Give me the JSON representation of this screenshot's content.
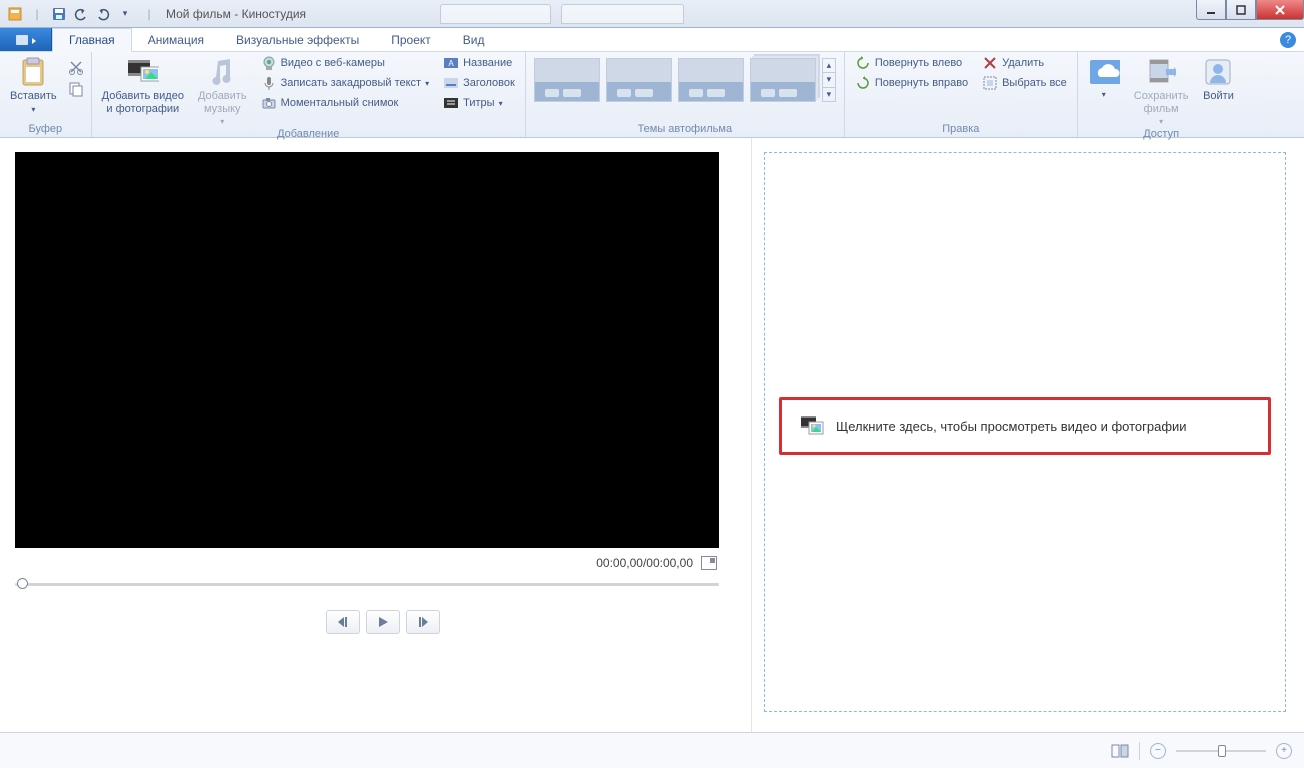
{
  "window": {
    "title": "Мой фильм - Киностудия"
  },
  "tabs": {
    "home": "Главная",
    "animation": "Анимация",
    "effects": "Визуальные эффекты",
    "project": "Проект",
    "view": "Вид"
  },
  "ribbon": {
    "clipboard": {
      "paste": "Вставить",
      "group": "Буфер"
    },
    "add": {
      "add_media": "Добавить видео\nи фотографии",
      "add_music": "Добавить\nмузыку",
      "webcam": "Видео с веб-камеры",
      "narration": "Записать закадровый текст",
      "snapshot": "Моментальный снимок",
      "title": "Название",
      "caption": "Заголовок",
      "credits": "Титры",
      "group": "Добавление"
    },
    "themes": {
      "group": "Темы автофильма"
    },
    "edit": {
      "rotate_left": "Повернуть влево",
      "rotate_right": "Повернуть вправо",
      "delete": "Удалить",
      "select_all": "Выбрать все",
      "group": "Правка"
    },
    "share": {
      "save_movie": "Сохранить\nфильм",
      "sign_in": "Войти",
      "group": "Доступ"
    }
  },
  "preview": {
    "time": "00:00,00/00:00,00"
  },
  "timeline": {
    "placeholder": "Щелкните здесь, чтобы просмотреть видео и фотографии"
  }
}
